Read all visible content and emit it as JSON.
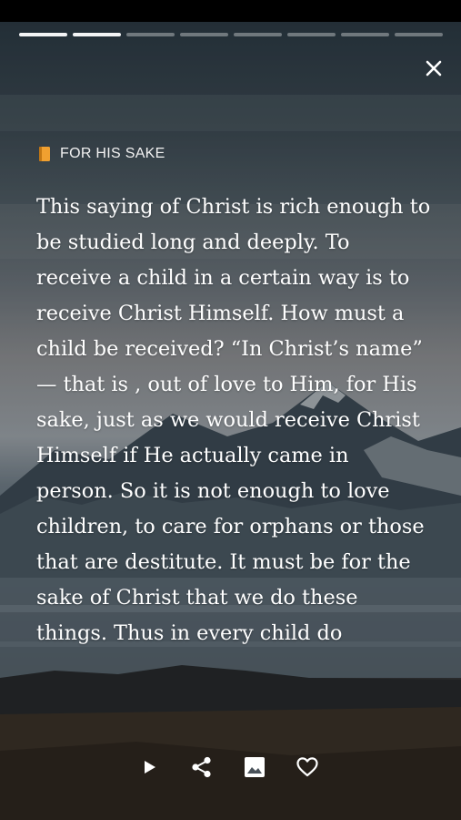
{
  "story": {
    "progress_segments_total": 8,
    "progress_segments_done": 2,
    "category_icon": "book-icon",
    "category_label": "FOR HIS SAKE",
    "body": "This saying of Christ is rich enough to be studied long and deeply. To receive a child in a certain way is to receive Christ Himself. How must a child be received? “In Christ’s name” — that is , out of love to Him, for His sake, just as we would receive Christ Himself if He actually came in person. So it is not enough to love children, to care for orphans or those that are destitute. It must be for the sake of Christ that we do these things. Thus in every child do"
  },
  "controls": {
    "close_icon": "close-icon",
    "play_icon": "play-icon",
    "share_icon": "share-icon",
    "image_icon": "image-icon",
    "favorite_icon": "heart-outline-icon"
  },
  "colors": {
    "text": "#ffffff",
    "progress_active": "#f2f2f2",
    "progress_inactive": "#9aa3aa",
    "book_icon": "#f0a030"
  }
}
